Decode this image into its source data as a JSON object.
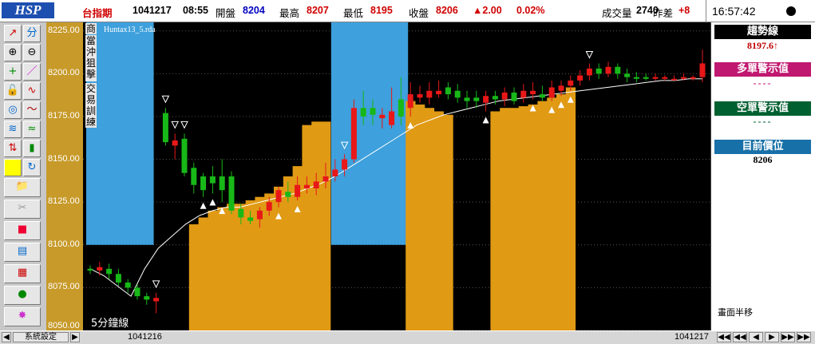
{
  "header": {
    "logo": "HSP",
    "symbol": "台指期",
    "date": "1041217",
    "time": "08:55",
    "open_label": "開盤",
    "open_value": "8204",
    "high_label": "最高",
    "high_value": "8207",
    "low_label": "最低",
    "low_value": "8195",
    "close_label": "收盤",
    "close_value": "8206",
    "change": "▲2.00",
    "change_pct": "0.02%",
    "volume_label": "成交量",
    "volume_value": "2740",
    "spread_label": "昨差",
    "spread_value": "+8",
    "clock": "16:57:42"
  },
  "chart": {
    "filename": "Huntax13_5.rda",
    "vertical_menu": [
      "商",
      "當沖狙擊",
      "交易訓練"
    ],
    "period_label": "5分鐘線",
    "y_ticks": [
      "8225.00",
      "8200.00",
      "8175.00",
      "8150.00",
      "8125.00",
      "8100.00",
      "8075.00",
      "8050.00"
    ],
    "x_start_label": "1041216",
    "x_end_label": "1041217"
  },
  "chart_data": {
    "type": "candlestick",
    "ylim": [
      8050,
      8230
    ],
    "y_ticks": [
      8225,
      8200,
      8175,
      8150,
      8125,
      8100,
      8075,
      8050
    ],
    "candles": [
      {
        "o": 8086,
        "c": 8085,
        "h": 8088,
        "l": 8083,
        "up": false
      },
      {
        "o": 8085,
        "c": 8087,
        "h": 8090,
        "l": 8082,
        "up": true
      },
      {
        "o": 8086,
        "c": 8083,
        "h": 8089,
        "l": 8080,
        "up": false
      },
      {
        "o": 8083,
        "c": 8078,
        "h": 8086,
        "l": 8076,
        "up": false
      },
      {
        "o": 8078,
        "c": 8075,
        "h": 8080,
        "l": 8072,
        "up": false
      },
      {
        "o": 8075,
        "c": 8070,
        "h": 8077,
        "l": 8068,
        "up": false
      },
      {
        "o": 8070,
        "c": 8068,
        "h": 8072,
        "l": 8065,
        "up": false
      },
      {
        "o": 8067,
        "c": 8069,
        "h": 8072,
        "l": 8060,
        "up": true
      },
      {
        "o": 8160,
        "c": 8177,
        "h": 8180,
        "l": 8158,
        "up": false
      },
      {
        "o": 8158,
        "c": 8161,
        "h": 8165,
        "l": 8150,
        "up": true
      },
      {
        "o": 8162,
        "c": 8142,
        "h": 8165,
        "l": 8140,
        "up": false
      },
      {
        "o": 8145,
        "c": 8135,
        "h": 8148,
        "l": 8130,
        "up": false
      },
      {
        "o": 8140,
        "c": 8132,
        "h": 8142,
        "l": 8128,
        "up": false
      },
      {
        "o": 8136,
        "c": 8140,
        "h": 8146,
        "l": 8130,
        "up": false
      },
      {
        "o": 8140,
        "c": 8132,
        "h": 8150,
        "l": 8125,
        "up": false
      },
      {
        "o": 8140,
        "c": 8120,
        "h": 8143,
        "l": 8118,
        "up": false
      },
      {
        "o": 8121,
        "c": 8116,
        "h": 8124,
        "l": 8112,
        "up": false
      },
      {
        "o": 8116,
        "c": 8114,
        "h": 8120,
        "l": 8112,
        "up": false
      },
      {
        "o": 8115,
        "c": 8120,
        "h": 8122,
        "l": 8110,
        "up": true
      },
      {
        "o": 8120,
        "c": 8125,
        "h": 8128,
        "l": 8117,
        "up": true
      },
      {
        "o": 8125,
        "c": 8132,
        "h": 8134,
        "l": 8122,
        "up": true
      },
      {
        "o": 8131,
        "c": 8128,
        "h": 8137,
        "l": 8125,
        "up": false
      },
      {
        "o": 8128,
        "c": 8135,
        "h": 8140,
        "l": 8126,
        "up": true
      },
      {
        "o": 8135,
        "c": 8133,
        "h": 8140,
        "l": 8130,
        "up": true
      },
      {
        "o": 8133,
        "c": 8137,
        "h": 8142,
        "l": 8129,
        "up": true
      },
      {
        "o": 8137,
        "c": 8140,
        "h": 8148,
        "l": 8133,
        "up": true
      },
      {
        "o": 8140,
        "c": 8144,
        "h": 8150,
        "l": 8137,
        "up": true
      },
      {
        "o": 8144,
        "c": 8150,
        "h": 8153,
        "l": 8140,
        "up": true
      },
      {
        "o": 8150,
        "c": 8180,
        "h": 8185,
        "l": 8148,
        "up": true
      },
      {
        "o": 8175,
        "c": 8180,
        "h": 8190,
        "l": 8170,
        "up": false
      },
      {
        "o": 8180,
        "c": 8176,
        "h": 8185,
        "l": 8170,
        "up": false
      },
      {
        "o": 8176,
        "c": 8174,
        "h": 8180,
        "l": 8168,
        "up": true
      },
      {
        "o": 8170,
        "c": 8178,
        "h": 8192,
        "l": 8168,
        "up": true
      },
      {
        "o": 8175,
        "c": 8185,
        "h": 8198,
        "l": 8170,
        "up": false
      },
      {
        "o": 8180,
        "c": 8188,
        "h": 8195,
        "l": 8175,
        "up": true
      },
      {
        "o": 8188,
        "c": 8186,
        "h": 8193,
        "l": 8183,
        "up": true
      },
      {
        "o": 8186,
        "c": 8190,
        "h": 8195,
        "l": 8182,
        "up": true
      },
      {
        "o": 8188,
        "c": 8190,
        "h": 8196,
        "l": 8186,
        "up": true
      },
      {
        "o": 8192,
        "c": 8188,
        "h": 8195,
        "l": 8185,
        "up": false
      },
      {
        "o": 8190,
        "c": 8186,
        "h": 8194,
        "l": 8183,
        "up": false
      },
      {
        "o": 8186,
        "c": 8184,
        "h": 8190,
        "l": 8180,
        "up": false
      },
      {
        "o": 8184,
        "c": 8186,
        "h": 8190,
        "l": 8180,
        "up": false
      },
      {
        "o": 8183,
        "c": 8187,
        "h": 8190,
        "l": 8178,
        "up": true
      },
      {
        "o": 8187,
        "c": 8185,
        "h": 8190,
        "l": 8182,
        "up": false
      },
      {
        "o": 8185,
        "c": 8189,
        "h": 8192,
        "l": 8181,
        "up": true
      },
      {
        "o": 8189,
        "c": 8184,
        "h": 8192,
        "l": 8182,
        "up": false
      },
      {
        "o": 8186,
        "c": 8190,
        "h": 8194,
        "l": 8183,
        "up": true
      },
      {
        "o": 8190,
        "c": 8188,
        "h": 8195,
        "l": 8185,
        "up": true
      },
      {
        "o": 8188,
        "c": 8186,
        "h": 8193,
        "l": 8184,
        "up": false
      },
      {
        "o": 8186,
        "c": 8192,
        "h": 8196,
        "l": 8184,
        "up": true
      },
      {
        "o": 8190,
        "c": 8193,
        "h": 8196,
        "l": 8187,
        "up": true
      },
      {
        "o": 8193,
        "c": 8196,
        "h": 8199,
        "l": 8190,
        "up": true
      },
      {
        "o": 8196,
        "c": 8199,
        "h": 8202,
        "l": 8193,
        "up": true
      },
      {
        "o": 8199,
        "c": 8203,
        "h": 8206,
        "l": 8196,
        "up": true
      },
      {
        "o": 8203,
        "c": 8200,
        "h": 8206,
        "l": 8197,
        "up": false
      },
      {
        "o": 8200,
        "c": 8204,
        "h": 8207,
        "l": 8198,
        "up": true
      },
      {
        "o": 8204,
        "c": 8200,
        "h": 8206,
        "l": 8197,
        "up": false
      },
      {
        "o": 8200,
        "c": 8198,
        "h": 8203,
        "l": 8195,
        "up": false
      },
      {
        "o": 8198,
        "c": 8197,
        "h": 8201,
        "l": 8195,
        "up": false
      },
      {
        "o": 8198,
        "c": 8197,
        "h": 8200,
        "l": 8196,
        "up": false
      },
      {
        "o": 8197,
        "c": 8198,
        "h": 8200,
        "l": 8196,
        "up": true
      },
      {
        "o": 8198,
        "c": 8197,
        "h": 8199,
        "l": 8196,
        "up": true
      },
      {
        "o": 8197,
        "c": 8197,
        "h": 8199,
        "l": 8196,
        "up": true
      },
      {
        "o": 8197,
        "c": 8198,
        "h": 8200,
        "l": 8196,
        "up": true
      },
      {
        "o": 8198,
        "c": 8197,
        "h": 8199,
        "l": 8196,
        "up": true
      },
      {
        "o": 8198,
        "c": 8206,
        "h": 8214,
        "l": 8195,
        "up": true
      }
    ],
    "trend_line": [
      8086,
      8082,
      8076,
      8070,
      8086,
      8098,
      8105,
      8112,
      8117,
      8120,
      8122,
      8122,
      8124,
      8126,
      8128,
      8130,
      8133,
      8136,
      8140,
      8145,
      8150,
      8155,
      8160,
      8165,
      8170,
      8173,
      8176,
      8178,
      8180,
      8182,
      8184,
      8185,
      8186,
      8187,
      8188,
      8189,
      8190,
      8191,
      8192,
      8193,
      8194,
      8195,
      8196,
      8196,
      8197,
      8197
    ],
    "blue_zones": [
      {
        "from": 0,
        "to": 7,
        "top": 8225
      },
      {
        "from": 26,
        "to": 34,
        "top": 8225
      }
    ],
    "orange_zones": [
      {
        "from": 11,
        "to": 26,
        "profile": [
          8112,
          8116,
          8120,
          8122,
          8124,
          8124,
          8126,
          8128,
          8130,
          8134,
          8140,
          8146,
          8170,
          8172,
          8172
        ]
      },
      {
        "from": 34,
        "to": 39,
        "profile": [
          8184,
          8182,
          8180,
          8178,
          8176
        ]
      },
      {
        "from": 43,
        "to": 52,
        "profile": [
          8178,
          8180,
          8180,
          8181,
          8182,
          8184,
          8186,
          8188,
          8192
        ]
      }
    ],
    "buy_signals": [
      12,
      13,
      14,
      20,
      22,
      34,
      42,
      47,
      49,
      50,
      51
    ],
    "sell_signals": [
      7,
      8,
      9,
      10,
      27,
      53
    ]
  },
  "toolbar": {
    "icons": [
      "trend-line-icon",
      "fibonacci-icon",
      "zoom-in-icon",
      "zoom-out-icon",
      "crosshair-icon",
      "pen-icon",
      "lock-icon",
      "wave-icon",
      "target-icon",
      "curve-icon",
      "indicator-icon",
      "pattern-icon",
      "flip-icon",
      "candle-icon",
      "color-box-icon",
      "refresh-icon",
      "folder-icon",
      "scissors-icon",
      "stop-icon",
      "window-icon",
      "grid-icon",
      "boxing-icon",
      "star-burst-icon"
    ]
  },
  "right_panel": {
    "trend_title": "趨勢線",
    "trend_value": "8197.6↑",
    "long_title": "多單警示值",
    "long_value": "----",
    "short_title": "空單警示值",
    "short_value": "----",
    "position_title": "目前價位",
    "position_value": "8206",
    "footer_note": "畫面半移"
  },
  "statusbar": {
    "settings_label": "系統設定",
    "nav_buttons": [
      "◀◀",
      "◀◀",
      "◀",
      "▶",
      "▶▶",
      "▶▶"
    ]
  },
  "colors": {
    "up": "#e81818",
    "down": "#18b818",
    "blue_zone": "#3ea0dc",
    "orange_zone": "#e09a14",
    "trend": "#ffffff",
    "axis_bg": "#c79a2a",
    "trend_header": "#000000",
    "long_header": "#c01870",
    "short_header": "#006030",
    "position_header": "#1870a8"
  }
}
